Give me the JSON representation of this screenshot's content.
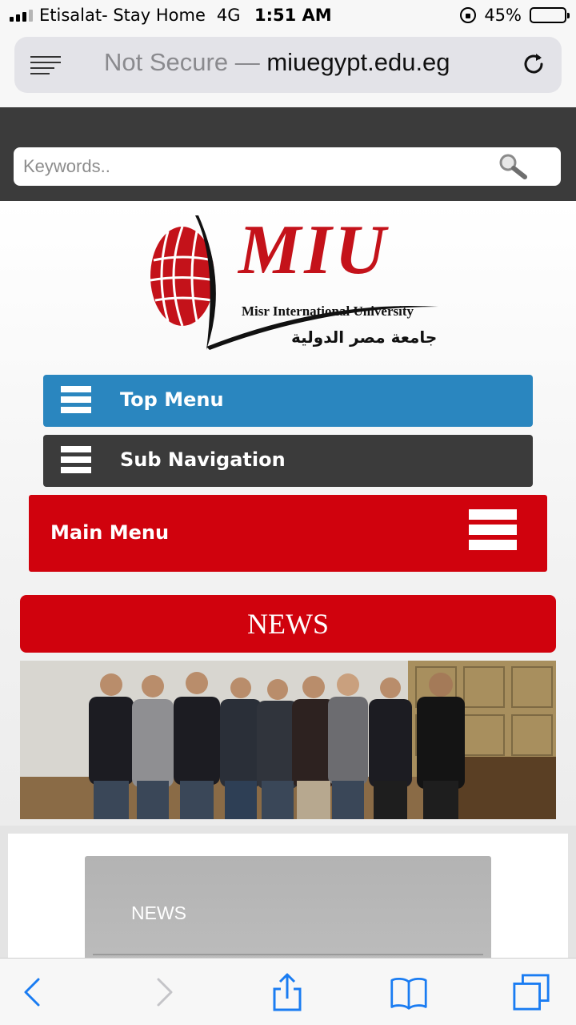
{
  "status_bar": {
    "carrier": "Etisalat- Stay Home",
    "network": "4G",
    "time": "1:51 AM",
    "battery_percent_label": "45%",
    "battery_level": 0.45
  },
  "browser": {
    "security_label": "Not Secure —",
    "host": "miuegypt.edu.eg"
  },
  "search": {
    "placeholder": "Keywords.."
  },
  "logo": {
    "mark": "MIU",
    "english_name": "Misr International University",
    "arabic_name": "جامعة مصر الدولية"
  },
  "menus": {
    "top_menu": "Top Menu",
    "sub_navigation": "Sub Navigation",
    "main_menu": "Main Menu"
  },
  "news": {
    "header": "NEWS",
    "tab_label": "NEWS"
  },
  "colors": {
    "accent_blue": "#2a86bf",
    "dark_gray": "#3b3b3b",
    "brand_red": "#d0020d",
    "ios_blue": "#1a7cf2"
  },
  "toolbar": {
    "icons": [
      "back-icon",
      "forward-icon",
      "share-icon",
      "bookmarks-icon",
      "tabs-icon"
    ]
  }
}
